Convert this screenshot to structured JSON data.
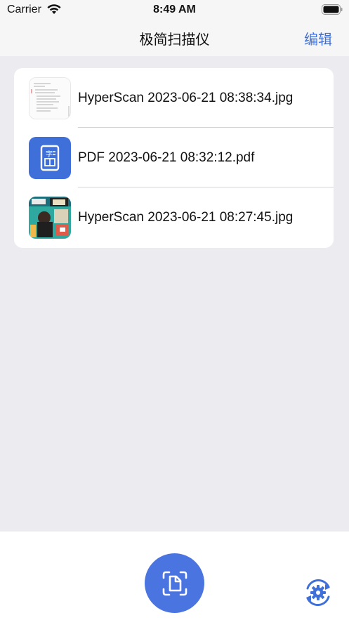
{
  "status": {
    "carrier": "Carrier",
    "time": "8:49 AM"
  },
  "nav": {
    "title": "极简扫描仪",
    "edit_label": "编辑"
  },
  "files": [
    {
      "name": "HyperScan 2023-06-21 08:38:34.jpg",
      "thumb": "document-page-thumbnail"
    },
    {
      "name": "PDF 2023-06-21 08:32:12.pdf",
      "thumb": "pdf-file-icon"
    },
    {
      "name": "HyperScan 2023-06-21 08:27:45.jpg",
      "thumb": "magazine-cover-thumbnail"
    }
  ],
  "toolbar": {
    "scan_icon": "document-scan-icon",
    "settings_icon": "gear-sync-icon"
  },
  "colors": {
    "accent": "#3f70da",
    "scan_button": "#4a74e0",
    "background": "#ebebf0"
  }
}
